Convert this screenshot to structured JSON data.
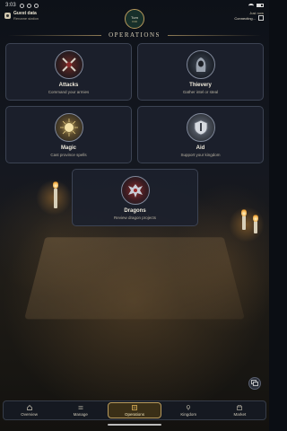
{
  "status_bar": {
    "time": "3:03"
  },
  "header": {
    "guest_title": "Guest data",
    "guest_sub": "Rename station",
    "turn_line1": "Turn",
    "turn_line2": "0:00",
    "sync_label": "Just now",
    "sync_status": "Connecting..."
  },
  "section": {
    "title": "OPERATIONS"
  },
  "cards": {
    "attacks": {
      "title": "Attacks",
      "subtitle": "Command your armies",
      "icon": "crossed-swords-icon"
    },
    "thievery": {
      "title": "Thievery",
      "subtitle": "Gather intel or steal",
      "icon": "hooded-figure-icon"
    },
    "magic": {
      "title": "Magic",
      "subtitle": "Cast province spells",
      "icon": "glowing-orb-icon"
    },
    "aid": {
      "title": "Aid",
      "subtitle": "Support your kingdom",
      "icon": "shield-icon"
    },
    "dragons": {
      "title": "Dragons",
      "subtitle": "Review dragon projects",
      "icon": "dragon-icon"
    }
  },
  "bottom_nav": {
    "tabs": [
      {
        "label": "Overview",
        "icon": "home-icon"
      },
      {
        "label": "Manage",
        "icon": "sliders-icon"
      },
      {
        "label": "Operations",
        "icon": "operations-icon",
        "active": true
      },
      {
        "label": "Kingdom",
        "icon": "pin-icon"
      },
      {
        "label": "Market",
        "icon": "market-icon"
      }
    ]
  },
  "colors": {
    "accent_gold": "#b89a5c",
    "card_bg": "#1c212c",
    "active_tab_bg": "#3a2f17"
  }
}
